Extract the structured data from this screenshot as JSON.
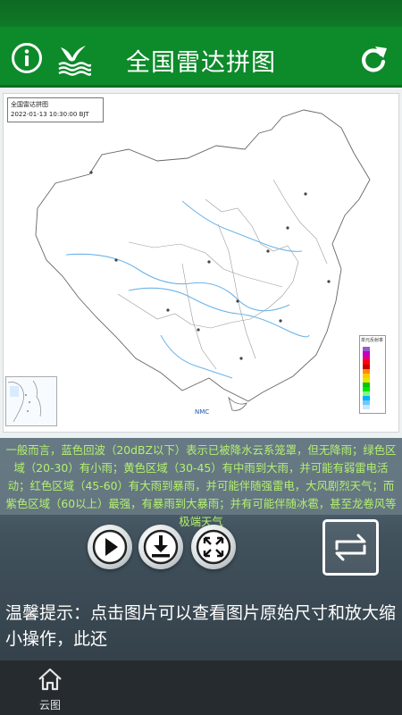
{
  "header": {
    "title": "全国雷达拼图",
    "info_icon": "info-icon",
    "logo_icon": "seagull-logo-icon",
    "refresh_icon": "refresh-icon"
  },
  "map": {
    "label_title": "全国雷达拼图",
    "label_time": "2022-01-13 10:30:00 BJT",
    "watermark": "NMC",
    "legend_title": "单元反射率"
  },
  "description": "一般而言，蓝色回波（20dBZ以下）表示已被降水云系笼罩，但无降雨；绿色区域（20-30）有小雨；黄色区域（30-45）有中雨到大雨，并可能有弱雷电活动；红色区域（45-60）有大雨到暴雨，并可能伴随强雷电，大风剧烈天气；而紫色区域（60以上）最强，有暴雨到大暴雨；并有可能伴随冰雹，甚至龙卷风等极端天气",
  "controls": {
    "play_icon": "play-icon",
    "download_icon": "download-icon",
    "fullscreen_icon": "fullscreen-icon",
    "swap_icon": "swap-icon"
  },
  "tip": "温馨提示：点击图片可以查看图片原始尺寸和放大缩小操作，此还",
  "nav": {
    "items": [
      {
        "label": "云图",
        "icon": "home-icon"
      }
    ]
  },
  "colors": {
    "header_green": "#0d8a2a",
    "description_text": "#b4f06f",
    "nav_bg": "#262b30"
  }
}
